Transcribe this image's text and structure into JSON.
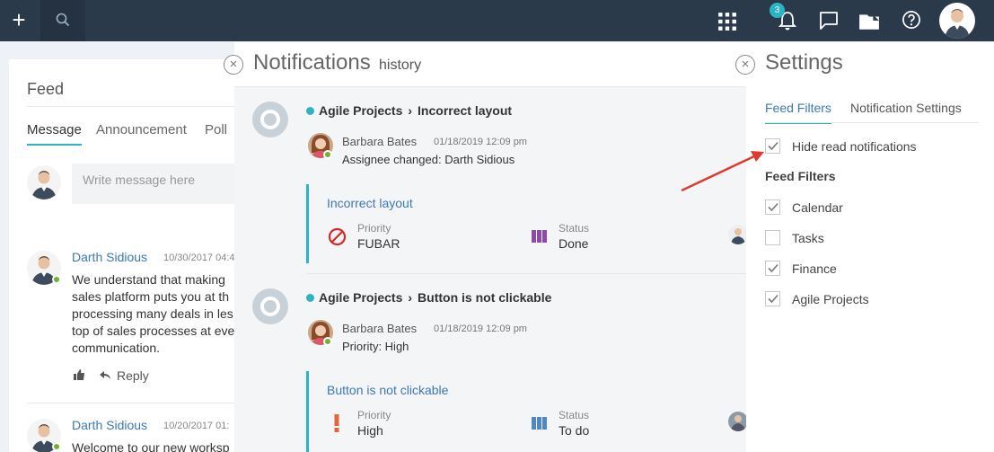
{
  "topbar": {
    "add_icon": "plus-icon",
    "search_icon": "search-icon",
    "notifications_badge": "3",
    "icons": [
      "apps-grid-icon",
      "bell-icon",
      "chat-icon",
      "folder-icon",
      "help-icon"
    ]
  },
  "feed": {
    "title": "Feed",
    "tabs": [
      "Message",
      "Announcement",
      "Poll"
    ],
    "write_placeholder": "Write message here",
    "posts": [
      {
        "author": "Darth Sidious",
        "date": "10/30/2017 04:4",
        "text": "We understand that making\nsales platform puts you at th\nprocessing many deals in les\ntop of sales processes at eve\ncommunication.",
        "reply_label": "Reply"
      },
      {
        "author": "Darth Sidious",
        "date": "10/20/2017 01:",
        "text": "Welcome to our new worksp"
      }
    ]
  },
  "notifications": {
    "title": "Notifications",
    "subtitle": "history",
    "items": [
      {
        "project": "Agile Projects",
        "task": "Incorrect layout",
        "user": "Barbara Bates",
        "date": "01/18/2019 12:09 pm",
        "change": "Assignee changed: Darth Sidious",
        "card_title": "Incorrect layout",
        "priority_label": "Priority",
        "priority_value": "FUBAR",
        "status_label": "Status",
        "status_value": "Done"
      },
      {
        "project": "Agile Projects",
        "task": "Button is not clickable",
        "user": "Barbara Bates",
        "date": "01/18/2019 12:09 pm",
        "change": "Priority: High",
        "card_title": "Button is not clickable",
        "priority_label": "Priority",
        "priority_value": "High",
        "status_label": "Status",
        "status_value": "To do"
      }
    ]
  },
  "settings": {
    "title": "Settings",
    "tabs": [
      "Feed Filters",
      "Notification Settings"
    ],
    "hide_read_label": "Hide read notifications",
    "hide_read_checked": true,
    "section_title": "Feed Filters",
    "filters": [
      {
        "label": "Calendar",
        "checked": true
      },
      {
        "label": "Tasks",
        "checked": false
      },
      {
        "label": "Finance",
        "checked": true
      },
      {
        "label": "Agile Projects",
        "checked": true
      }
    ]
  },
  "colors": {
    "topbar": "#2b3a4a",
    "accent": "#2bb5c4",
    "link": "#3a7ab3",
    "online": "#6ab42d",
    "fubar": "#d9262a",
    "high": "#e4663b",
    "done": "#8e4aa8",
    "todo": "#4f86c6",
    "arrow": "#e03a2e"
  }
}
